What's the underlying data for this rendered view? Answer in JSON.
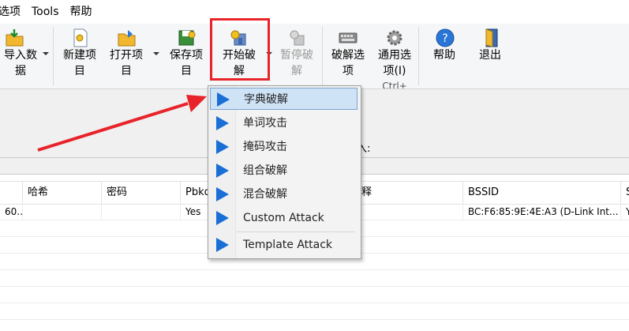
{
  "menu": {
    "items": [
      "选项",
      "Tools",
      "帮助"
    ]
  },
  "toolbar": {
    "import": "导入数\n据",
    "new_project": "新建项\n目",
    "open_project": "打开项\n目",
    "save_project": "保存项\n目",
    "start_crack": "开始破\n解",
    "pause_crack": "暂停破\n解",
    "crack_options": "破解选\n项",
    "general_options": "通用选\n项(I)",
    "help": "帮助",
    "exit": "退出",
    "partial_hidden": "Ctrl+"
  },
  "infopanel": {
    "line4_suffix": "入:"
  },
  "table": {
    "headers": [
      "",
      "哈希",
      "密码",
      "Pbkdl",
      "",
      "注释",
      "BSSID",
      "S"
    ],
    "rows": [
      [
        "60...",
        "",
        "",
        "Yes",
        "",
        "",
        "BC:F6:85:9E:4E:A3 (D-Link Int...",
        "Y"
      ]
    ]
  },
  "dropdown": {
    "items": [
      "字典破解",
      "单词攻击",
      "掩码攻击",
      "组合破解",
      "混合破解",
      "Custom Attack",
      "Template Attack"
    ]
  },
  "colors": {
    "highlight": "#e8232a",
    "play": "#1a6fd6"
  }
}
